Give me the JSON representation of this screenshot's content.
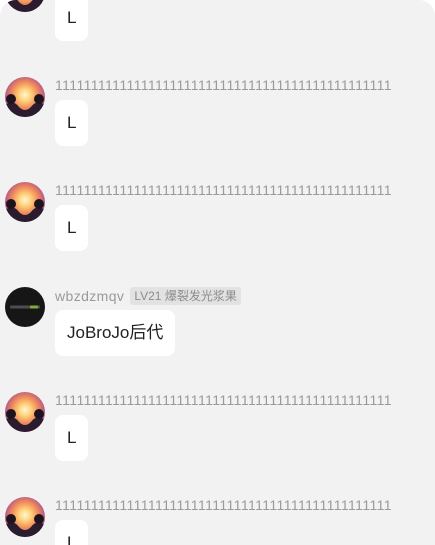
{
  "messages": [
    {
      "avatar": "sunset-avatar",
      "name": "",
      "text": "L"
    },
    {
      "avatar": "sunset-avatar",
      "name": "11111111111111111111111111111111111111111111111",
      "text": "L"
    },
    {
      "avatar": "sunset-avatar",
      "name": "11111111111111111111111111111111111111111111111",
      "text": "L"
    },
    {
      "avatar": "dark-logo-avatar",
      "name": "wbzdzmqv",
      "badge": "LV21 爆裂发光浆果",
      "text": "JoBroJo后代"
    },
    {
      "avatar": "sunset-avatar",
      "name": "11111111111111111111111111111111111111111111111",
      "text": "L"
    },
    {
      "avatar": "sunset-avatar",
      "name": "11111111111111111111111111111111111111111111111",
      "text": "L"
    }
  ]
}
